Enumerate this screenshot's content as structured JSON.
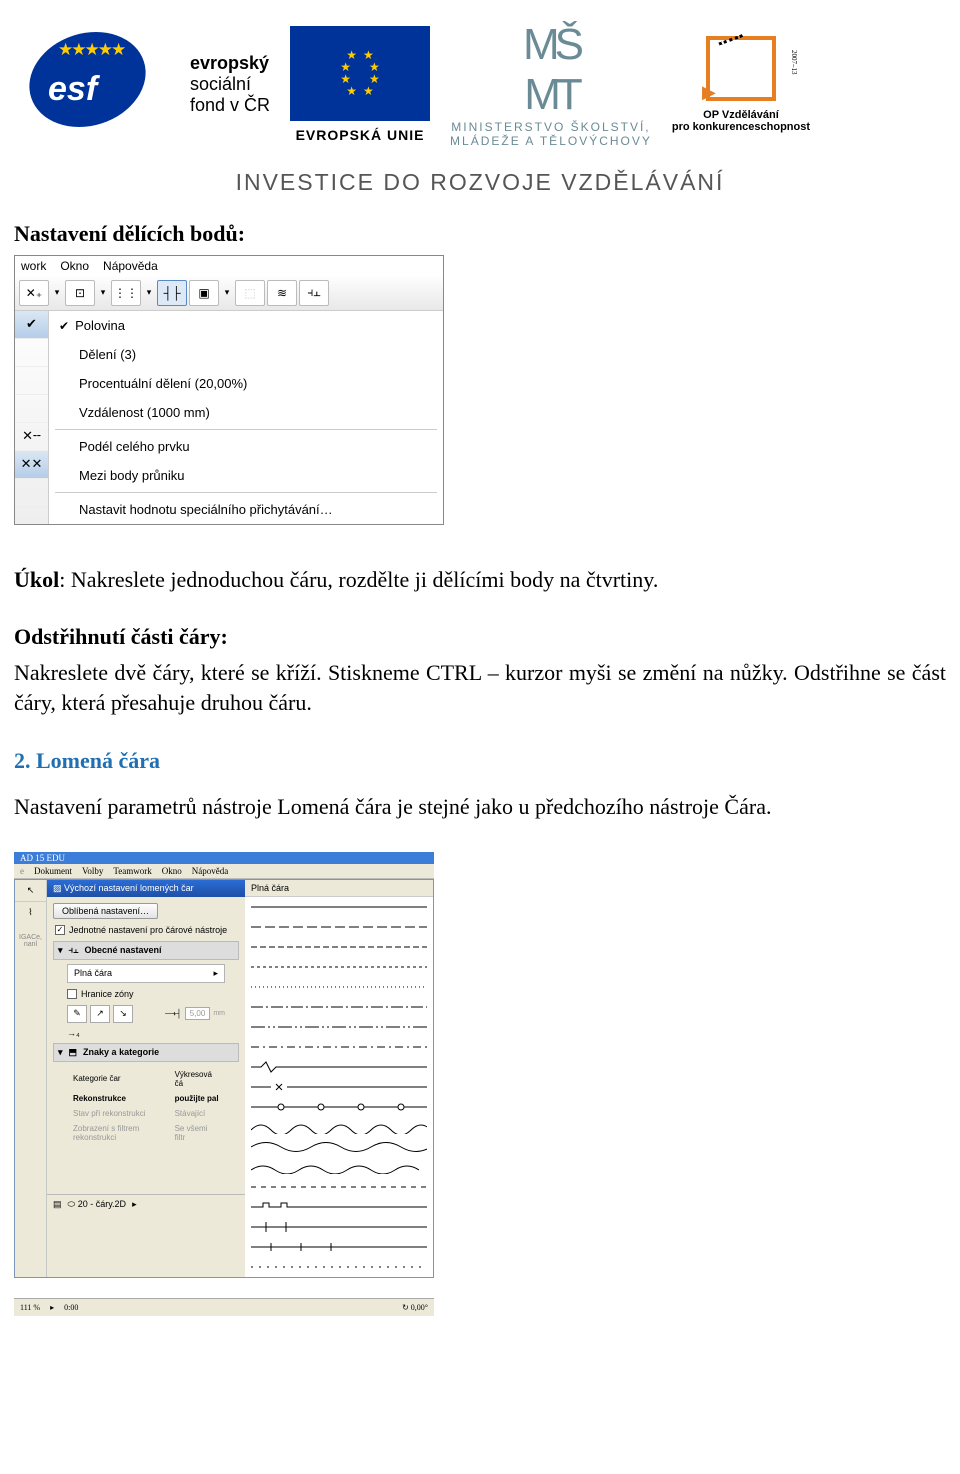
{
  "header": {
    "esf_abbrev": "esf",
    "esf_text1": "evropský",
    "esf_text2": "sociální",
    "esf_text3": "fond v ČR",
    "eu_label": "EVROPSKÁ UNIE",
    "msmt_line1": "MINISTERSTVO ŠKOLSTVÍ,",
    "msmt_line2": "MLÁDEŽE A TĚLOVÝCHOVY",
    "opvk_year": "2007–13",
    "opvk_line1": "OP Vzdělávání",
    "opvk_line2": "pro konkurenceschopnost",
    "tagline": "INVESTICE DO ROZVOJE VZDĚLÁVÁNÍ"
  },
  "content": {
    "heading1": "Nastavení dělících bodů:",
    "snap_menu": {
      "menubar": [
        "work",
        "Okno",
        "Nápověda"
      ],
      "items": [
        "Polovina",
        "Dělení (3)",
        "Procentuální dělení (20,00%)",
        "Vzdálenost (1000 mm)",
        "Podél celého prvku",
        "Mezi body průniku",
        "Nastavit hodnotu speciálního přichytávání…"
      ]
    },
    "task_label": "Úkol",
    "task_text": ": Nakreslete jednoduchou čáru, rozdělte ji dělícími body na čtvrtiny.",
    "heading2": "Odstřihnutí části čáry:",
    "body2": "Nakreslete dvě čáry, které se kříží. Stiskneme CTRL – kurzor myši se změní na nůžky. Odstřihne se část čáry, která přesahuje druhou čáru.",
    "section_title": "2. Lomená čára",
    "section_intro": "Nastavení parametrů nástroje Lomená čára je stejné jako u předchozího nástroje Čára.",
    "settings": {
      "app_menu": [
        "Dokument",
        "Volby",
        "Teamwork",
        "Okno",
        "Nápověda"
      ],
      "app_label": "AD 15 EDU",
      "title": "Výchozí nastavení lomených čar",
      "favorites_btn": "Oblíbená nastavení…",
      "uniform_check": "Jednotné nastavení pro čárové nástroje",
      "section_general": "Obecné nastavení",
      "field_linetype": "Plná čára",
      "field_zone": "Hranice zóny",
      "section_cats": "Znaky a kategorie",
      "table_headers": [
        "Kategorie čar",
        "Výkresová čá"
      ],
      "table_rows": [
        [
          "Rekonstrukce",
          "použijte pal"
        ],
        [
          "Stav při rekonstrukci",
          "Stávající"
        ],
        [
          "Zobrazení s filtrem rekonstrukci",
          "Se všemi filtr"
        ]
      ],
      "layer_label": "20 - čáry.2D",
      "linetypes_title": "Plná čára",
      "status_zoom": "111 %",
      "status_time": "0:00",
      "status_coord": "0,00°"
    }
  }
}
